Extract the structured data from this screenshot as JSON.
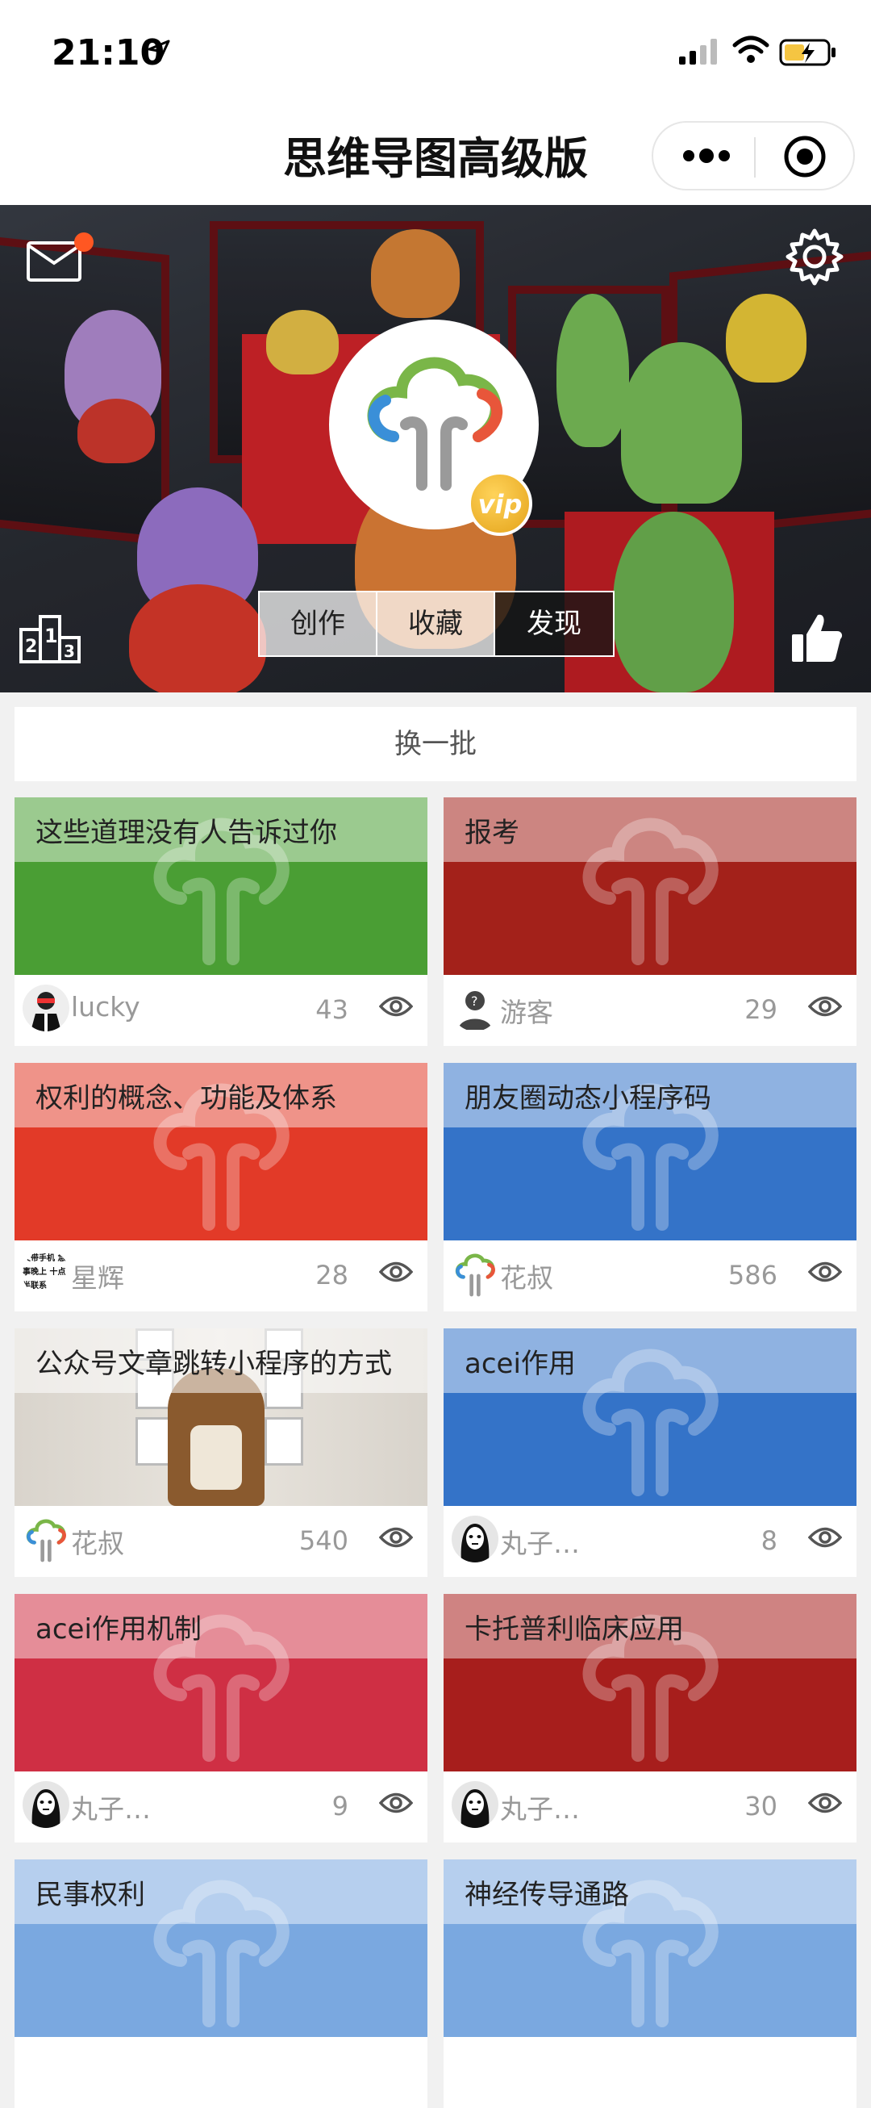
{
  "status": {
    "time": "21:10"
  },
  "nav": {
    "title": "思维导图高级版"
  },
  "hero": {
    "segments": [
      "创作",
      "收藏",
      "发现"
    ],
    "active_segment": "发现",
    "vip_label": "vip"
  },
  "refresh_label": "换一批",
  "colors": {
    "green": "#4a9e34",
    "dark_red": "#a3211a",
    "red": "#e23a28",
    "blue": "#3473c8",
    "rose": "#cf2f44",
    "brick": "#a71e1c",
    "light_blue": "#7aa8e0"
  },
  "cards": [
    {
      "title": "这些道理没有人告诉过你",
      "author": "lucky",
      "views": "43",
      "color": "#4a9e34"
    },
    {
      "title": "报考",
      "author": "游客",
      "views": "29",
      "color": "#a3211a"
    },
    {
      "title": "权利的概念、功能及体系",
      "author": "星辉",
      "views": "28",
      "color": "#e23a28"
    },
    {
      "title": "朋友圈动态小程序码",
      "author": "花叔",
      "views": "586",
      "color": "#3473c8"
    },
    {
      "title": "公众号文章跳转小程序的方式",
      "author": "花叔",
      "views": "540",
      "color": "photo"
    },
    {
      "title": "acei作用",
      "author": "丸子…",
      "views": "8",
      "color": "#3473c8"
    },
    {
      "title": "acei作用机制",
      "author": "丸子…",
      "views": "9",
      "color": "#cf2f44"
    },
    {
      "title": "卡托普利临床应用",
      "author": "丸子…",
      "views": "30",
      "color": "#a71e1c"
    },
    {
      "title": "民事权利",
      "author": "",
      "views": "",
      "color": "#7aa8e0"
    },
    {
      "title": "神经传导通路",
      "author": "",
      "views": "",
      "color": "#7aa8e0"
    }
  ],
  "avatar_text": "文带手机 急事晚上 十点半联系"
}
